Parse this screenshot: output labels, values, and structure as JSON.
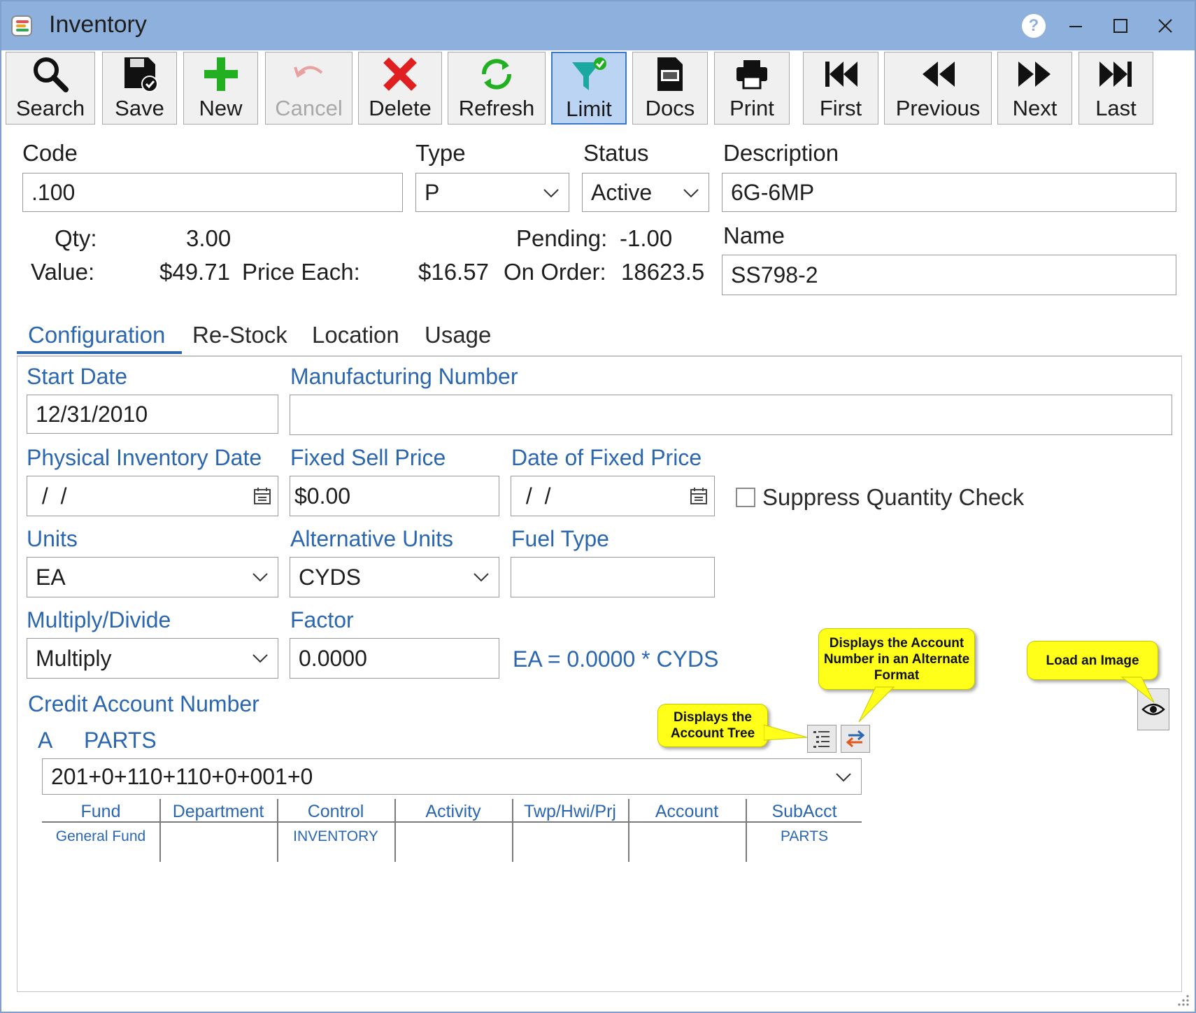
{
  "window": {
    "title": "Inventory"
  },
  "toolbar": {
    "buttons": [
      {
        "label": "Search",
        "icon": "search-icon"
      },
      {
        "label": "Save",
        "icon": "save-icon"
      },
      {
        "label": "New",
        "icon": "plus-icon"
      },
      {
        "label": "Cancel",
        "icon": "undo-icon",
        "disabled": true
      },
      {
        "label": "Delete",
        "icon": "x-icon"
      },
      {
        "label": "Refresh",
        "icon": "refresh-icon"
      },
      {
        "label": "Limit",
        "icon": "filter-icon",
        "active": true
      },
      {
        "label": "Docs",
        "icon": "document-icon"
      },
      {
        "label": "Print",
        "icon": "printer-icon"
      },
      {
        "label": "First",
        "icon": "first-icon"
      },
      {
        "label": "Previous",
        "icon": "previous-icon"
      },
      {
        "label": "Next",
        "icon": "next-icon"
      },
      {
        "label": "Last",
        "icon": "last-icon"
      }
    ]
  },
  "header": {
    "code_label": "Code",
    "code_value": ".100",
    "type_label": "Type",
    "type_value": "P",
    "status_label": "Status",
    "status_value": "Active",
    "description_label": "Description",
    "description_value": "6G-6MP",
    "name_label": "Name",
    "name_value": "SS798-2",
    "qty_label": "Qty:",
    "qty_value": "3.00",
    "pending_label": "Pending:",
    "pending_value": "-1.00",
    "value_label": "Value:",
    "value_value": "$49.71",
    "price_each_label": "Price Each:",
    "price_each_value": "$16.57",
    "on_order_label": "On Order:",
    "on_order_value": "18623.5"
  },
  "tabs": [
    {
      "label": "Configuration",
      "active": true
    },
    {
      "label": "Re-Stock"
    },
    {
      "label": "Location"
    },
    {
      "label": "Usage"
    }
  ],
  "config": {
    "start_date_label": "Start Date",
    "start_date_value": "12/31/2010",
    "mfg_number_label": "Manufacturing Number",
    "mfg_number_value": "",
    "phys_inv_date_label": "Physical Inventory Date",
    "phys_inv_date_value": " /  /",
    "fixed_sell_price_label": "Fixed Sell Price",
    "fixed_sell_price_value": "$0.00",
    "date_fixed_price_label": "Date of Fixed Price",
    "date_fixed_price_value": " /  /",
    "suppress_qty_label": "Suppress Quantity Check",
    "suppress_qty_checked": false,
    "units_label": "Units",
    "units_value": "EA",
    "alt_units_label": "Alternative Units",
    "alt_units_value": "CYDS",
    "fuel_type_label": "Fuel Type",
    "fuel_type_value": "",
    "multiply_divide_label": "Multiply/Divide",
    "multiply_divide_value": "Multiply",
    "factor_label": "Factor",
    "factor_value": "0.0000",
    "conversion_text": "EA = 0.0000 * CYDS",
    "credit_account_label": "Credit Account Number",
    "account_prefix": "A",
    "account_name": "PARTS",
    "account_number": "201+0+110+110+0+001+0",
    "account_columns": [
      "Fund",
      "Department",
      "Control",
      "Activity",
      "Twp/Hwi/Prj",
      "Account",
      "SubAcct"
    ],
    "account_values": [
      "General Fund",
      "",
      "INVENTORY",
      "",
      "",
      "",
      "PARTS"
    ]
  },
  "callouts": {
    "account_tree": "Displays the Account Tree",
    "alternate_format": "Displays the Account Number in an Alternate Format",
    "load_image": "Load an Image"
  },
  "colors": {
    "titlebar": "#8eb0dc",
    "accent_blue": "#2b66b1",
    "callout_yellow": "#ffff1a"
  }
}
